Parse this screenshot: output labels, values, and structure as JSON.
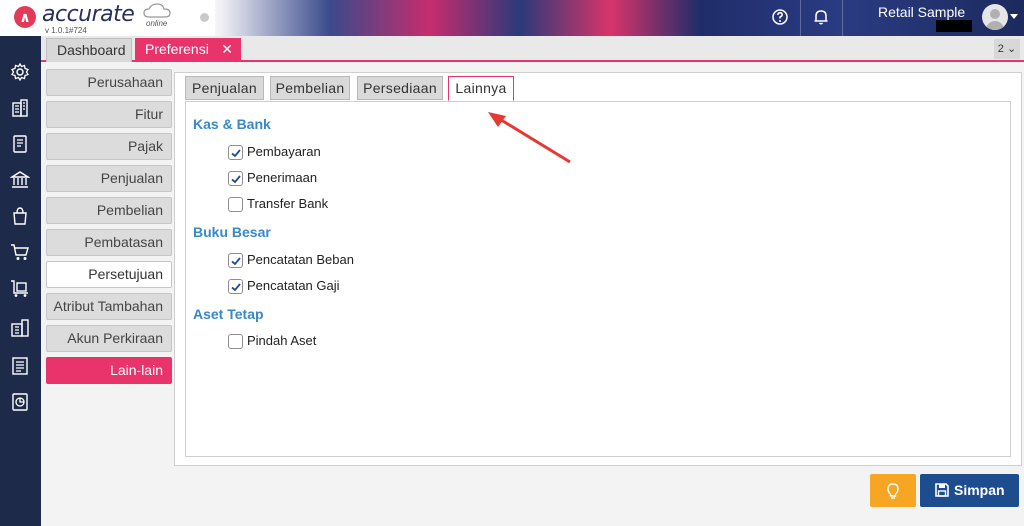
{
  "header": {
    "logo_text": "accurate",
    "logo_sub": "online",
    "version": "v 1.0.1#724",
    "user_name": "Retail Sample",
    "tab_count": "2 ⌄"
  },
  "tabs": {
    "dashboard": "Dashboard",
    "preferensi": "Preferensi",
    "close_glyph": "✕"
  },
  "side_menu": [
    "Perusahaan",
    "Fitur",
    "Pajak",
    "Penjualan",
    "Pembelian",
    "Pembatasan",
    "Persetujuan",
    "Atribut Tambahan",
    "Akun Perkiraan",
    "Lain-lain"
  ],
  "sub_tabs": [
    "Penjualan",
    "Pembelian",
    "Persediaan",
    "Lainnya"
  ],
  "sections": {
    "kas_bank": {
      "title": "Kas & Bank",
      "items": [
        {
          "label": "Pembayaran",
          "checked": true
        },
        {
          "label": "Penerimaan",
          "checked": true
        },
        {
          "label": "Transfer Bank",
          "checked": false
        }
      ]
    },
    "buku_besar": {
      "title": "Buku Besar",
      "items": [
        {
          "label": "Pencatatan Beban",
          "checked": true
        },
        {
          "label": "Pencatatan Gaji",
          "checked": true
        }
      ]
    },
    "aset_tetap": {
      "title": "Aset Tetap",
      "items": [
        {
          "label": "Pindah Aset",
          "checked": false
        }
      ]
    }
  },
  "buttons": {
    "save": "Simpan"
  },
  "colors": {
    "accent": "#e8336b",
    "section": "#3a88c8",
    "save_button": "#1d4d8f",
    "idea_button": "#f6a623",
    "nav_bg": "#1e2a4a"
  }
}
